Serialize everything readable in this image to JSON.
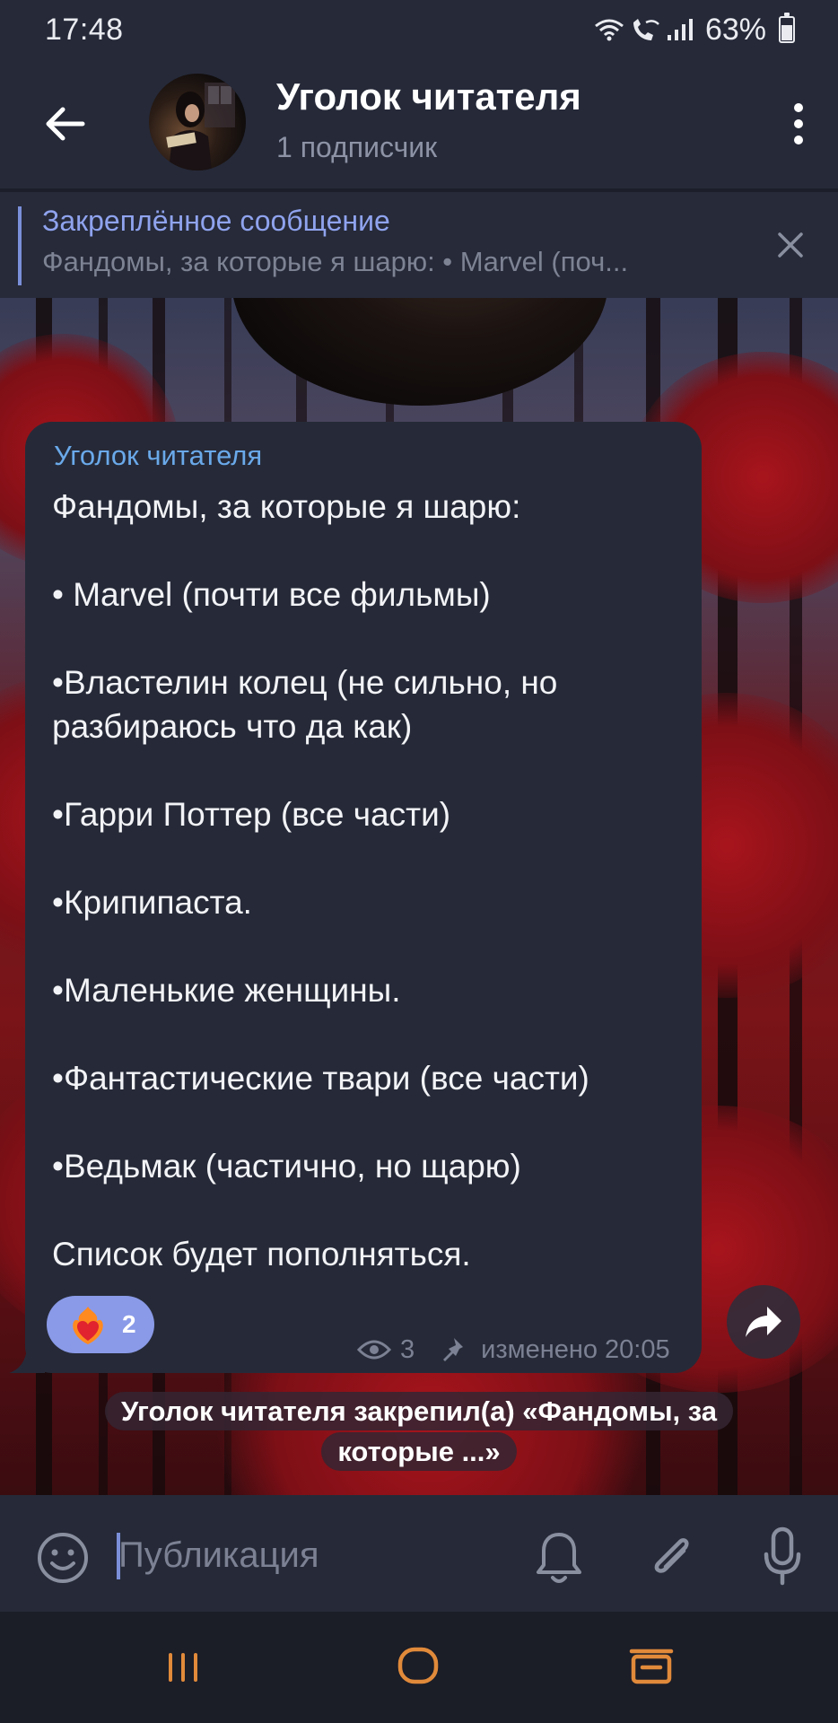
{
  "status_bar": {
    "time": "17:48",
    "battery": "63%"
  },
  "header": {
    "title": "Уголок читателя",
    "subtitle": "1 подписчик"
  },
  "pinned": {
    "title": "Закреплённое сообщение",
    "text": "Фандомы, за которые я шарю:  • Marvel (поч..."
  },
  "message": {
    "author": "Уголок читателя",
    "lines": [
      "Фандомы, за которые я шарю:",
      "",
      "• Marvel (почти все фильмы)",
      "",
      "•Властелин колец (не сильно, но",
      "разбираюсь что да как)",
      "",
      "•Гарри Поттер (все части)",
      "",
      "•Крипипаста.",
      "",
      "•Маленькие женщины.",
      "",
      "•Фантастические твари (все части)",
      "",
      "•Ведьмак (частично, но щарю)",
      "",
      "Список будет пополняться."
    ],
    "reaction_emoji": "heart-on-fire",
    "reaction_count": "2",
    "views": "3",
    "edited": "изменено 20:05"
  },
  "service_message": "Уголок читателя закрепил(а) «Фандомы, за которые ...»",
  "composer": {
    "placeholder": "Публикация"
  },
  "colors": {
    "accent": "#7b8fd9",
    "author": "#6aa9ea",
    "reaction": "#8a9ae8",
    "bubble": "#262a38"
  }
}
